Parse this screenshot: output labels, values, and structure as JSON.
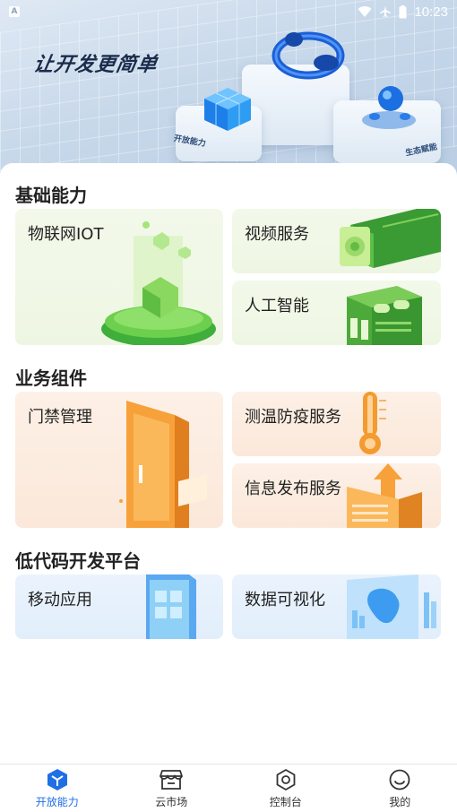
{
  "status_bar": {
    "time": "10:23"
  },
  "hero": {
    "slogan": "让开发更简单",
    "platform_left_label": "开放能力",
    "platform_right_label": "生态赋能"
  },
  "sections": {
    "basic": {
      "title": "基础能力",
      "cards": {
        "iot": "物联网IOT",
        "video": "视频服务",
        "ai": "人工智能"
      }
    },
    "business": {
      "title": "业务组件",
      "cards": {
        "access": "门禁管理",
        "temperature": "测温防疫服务",
        "info_release": "信息发布服务"
      }
    },
    "lowcode": {
      "title": "低代码开发平台",
      "cards": {
        "mobile": "移动应用",
        "dataviz": "数据可视化"
      }
    }
  },
  "bottom_nav": {
    "items": [
      {
        "label": "开放能力",
        "icon": "cube-icon",
        "active": true
      },
      {
        "label": "云市场",
        "icon": "store-icon",
        "active": false
      },
      {
        "label": "控制台",
        "icon": "gear-icon",
        "active": false
      },
      {
        "label": "我的",
        "icon": "smile-icon",
        "active": false
      }
    ]
  },
  "colors": {
    "accent": "#1f6fe5",
    "green_card": "#eef6e3",
    "orange_card": "#fbe8da",
    "blue_card": "#e2eefb"
  }
}
